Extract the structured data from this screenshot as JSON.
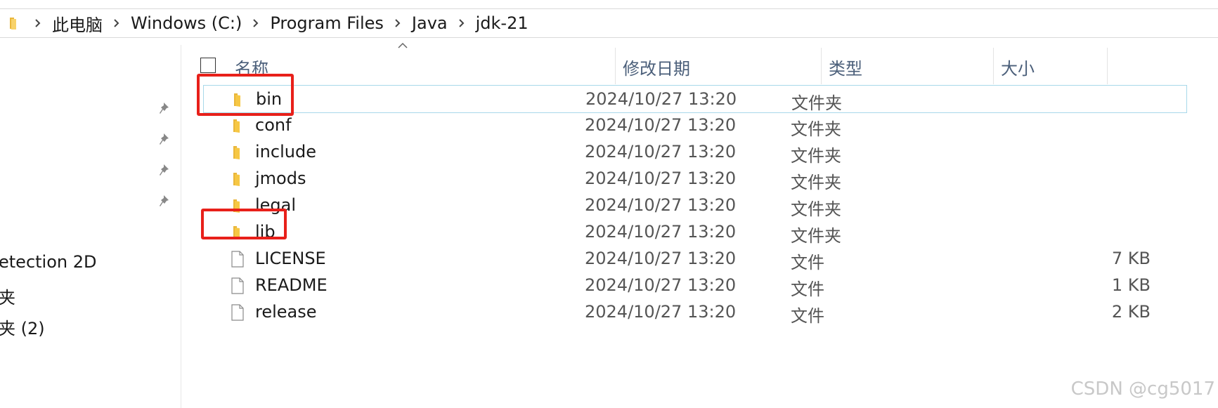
{
  "breadcrumb": {
    "items": [
      {
        "label": "此电脑"
      },
      {
        "label": "Windows (C:)"
      },
      {
        "label": "Program Files"
      },
      {
        "label": "Java"
      },
      {
        "label": "jdk-21"
      }
    ]
  },
  "navigation": {
    "items": [
      {
        "label": "etection 2D"
      },
      {
        "label": "夹"
      },
      {
        "label": "夹 (2)"
      }
    ],
    "pinned_count": 4
  },
  "columns": {
    "name": "名称",
    "modified": "修改日期",
    "type": "类型",
    "size": "大小"
  },
  "files": [
    {
      "name": "bin",
      "modified": "2024/10/27 13:20",
      "type": "文件夹",
      "size": "",
      "kind": "folder",
      "selected": true,
      "highlighted": true
    },
    {
      "name": "conf",
      "modified": "2024/10/27 13:20",
      "type": "文件夹",
      "size": "",
      "kind": "folder",
      "selected": false,
      "highlighted": false
    },
    {
      "name": "include",
      "modified": "2024/10/27 13:20",
      "type": "文件夹",
      "size": "",
      "kind": "folder",
      "selected": false,
      "highlighted": false
    },
    {
      "name": "jmods",
      "modified": "2024/10/27 13:20",
      "type": "文件夹",
      "size": "",
      "kind": "folder",
      "selected": false,
      "highlighted": false
    },
    {
      "name": "legal",
      "modified": "2024/10/27 13:20",
      "type": "文件夹",
      "size": "",
      "kind": "folder",
      "selected": false,
      "highlighted": false
    },
    {
      "name": "lib",
      "modified": "2024/10/27 13:20",
      "type": "文件夹",
      "size": "",
      "kind": "folder",
      "selected": false,
      "highlighted": true
    },
    {
      "name": "LICENSE",
      "modified": "2024/10/27 13:20",
      "type": "文件",
      "size": "7 KB",
      "kind": "file",
      "selected": false,
      "highlighted": false
    },
    {
      "name": "README",
      "modified": "2024/10/27 13:20",
      "type": "文件",
      "size": "1 KB",
      "kind": "file",
      "selected": false,
      "highlighted": false
    },
    {
      "name": "release",
      "modified": "2024/10/27 13:20",
      "type": "文件",
      "size": "2 KB",
      "kind": "file",
      "selected": false,
      "highlighted": false
    }
  ],
  "colors": {
    "highlight": "#e8201a",
    "selection_border": "#a8d8ea",
    "header_text": "#4b5f7a",
    "folder": "#f6c744"
  },
  "watermark": "CSDN @cg5017"
}
